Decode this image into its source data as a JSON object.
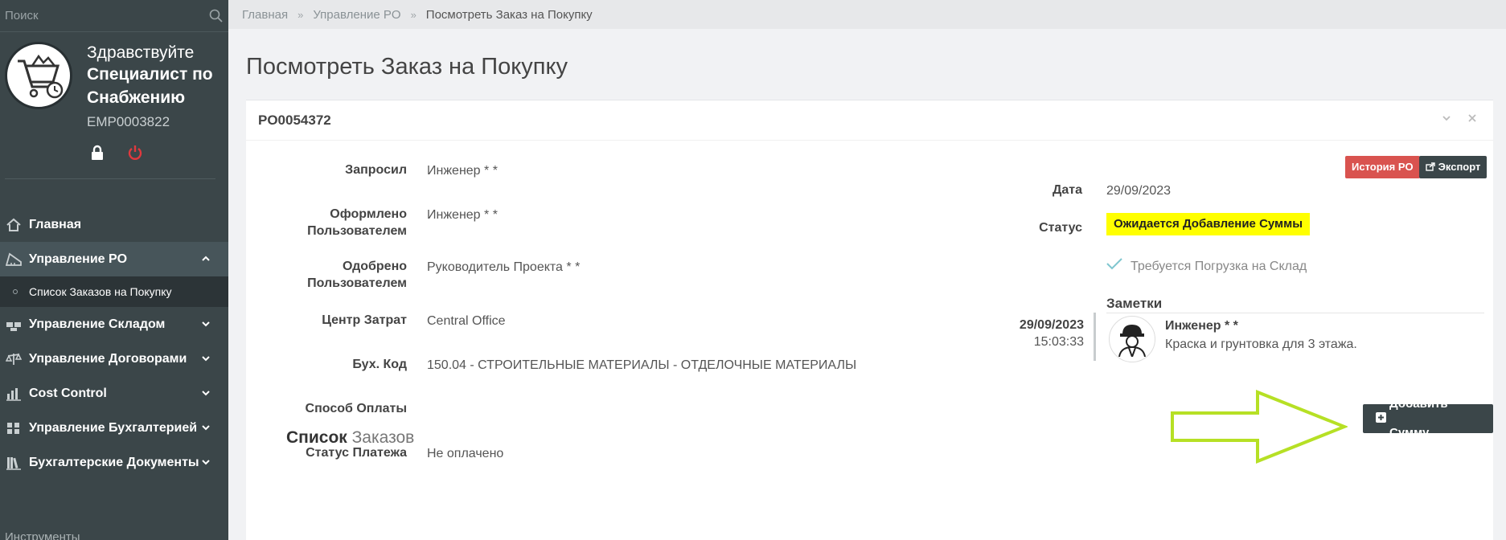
{
  "sidebar": {
    "search_placeholder": "Поиск",
    "greeting": "Здравствуйте",
    "role": "Специалист по Снабжению",
    "employee_id": "EMP0003822",
    "nav": [
      {
        "label": "Главная",
        "icon": "home-icon"
      },
      {
        "label": "Управление PO",
        "icon": "ruler-icon",
        "expanded": true
      },
      {
        "label": "Управление Складом",
        "icon": "warehouse-icon"
      },
      {
        "label": "Управление Договорами",
        "icon": "scales-icon"
      },
      {
        "label": "Cost Control",
        "icon": "bar-chart-icon"
      },
      {
        "label": "Управление Бухгалтерией",
        "icon": "calculator-icon"
      },
      {
        "label": "Бухгалтерские Документы",
        "icon": "books-icon"
      }
    ],
    "sub_item": "Список Заказов на Покупку",
    "tools_label": "Инструменты",
    "colors": {
      "background": "#3b4649",
      "active": "#47555a",
      "logout": "#e0393e"
    }
  },
  "breadcrumb": [
    "Главная",
    "Управление PO",
    "Посмотреть Заказ на Покупку"
  ],
  "page_title": "Посмотреть Заказ на Покупку",
  "panel": {
    "po_number": "PO0054372",
    "fields": {
      "requested_label": "Запросил",
      "requested_value": "Инженер * *",
      "created_label_1": "Оформлено",
      "created_label_2": "Пользователем",
      "created_value": "Инженер * *",
      "approved_label_1": "Одобрено",
      "approved_label_2": "Пользователем",
      "approved_value": "Руководитель Проекта * *",
      "cost_center_label": "Центр Затрат",
      "cost_center_value": "Central Office",
      "account_code_label": "Бух. Код",
      "account_code_value": "150.04 - СТРОИТЕЛЬНЫЕ МАТЕРИАЛЫ - ОТДЕЛОЧНЫЕ МАТЕРИАЛЫ",
      "payment_method_label": "Способ Оплаты",
      "payment_method_value": "",
      "payment_status_label": "Статус Платежа",
      "payment_status_value": "Не оплачено",
      "date_label": "Дата",
      "date_value": "29/09/2023",
      "status_label": "Статус",
      "status_value": "Ожидается Добавление Суммы",
      "warehouse_note": "Требуется Погрузка на Склад"
    },
    "history_button": "История PO",
    "export_button": "Экспорт",
    "notes": {
      "title": "Заметки",
      "date": "29/09/2023",
      "time": "15:03:33",
      "author": "Инженер * *",
      "text": "Краска и грунтовка для 3 этажа."
    },
    "add_amount_button": "Добавить Сумму",
    "list_title_bold": "Список",
    "list_title_light": "Заказов"
  }
}
